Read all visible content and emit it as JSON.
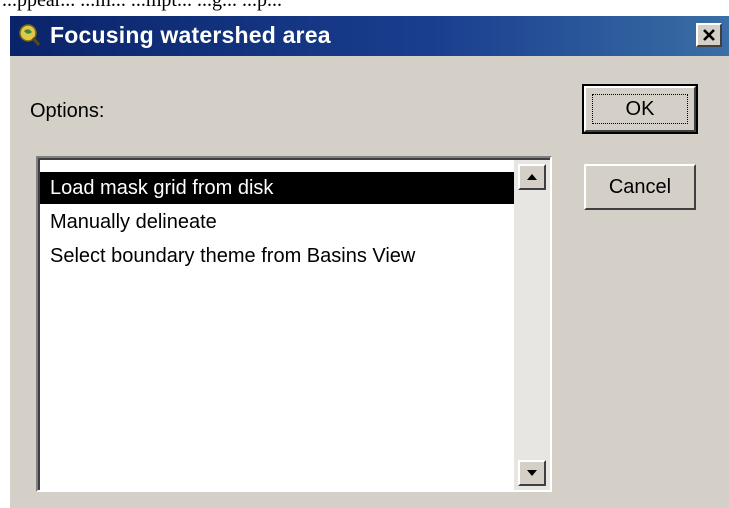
{
  "background_fragment": "...ppear... ...m... ...mpt... ...g... ...p...",
  "dialog": {
    "title": "Focusing watershed  area",
    "options_label": "Options:",
    "items": [
      "Load mask grid from disk",
      "Manually delineate",
      "Select boundary theme from Basins View"
    ],
    "selected_index": 0,
    "ok_label": "OK",
    "cancel_label": "Cancel"
  },
  "icons": {
    "app": "app-icon",
    "close": "close-icon",
    "scroll_up": "up-arrow-icon",
    "scroll_down": "down-arrow-icon"
  },
  "colors": {
    "titlebar": "#0a246a",
    "dialog_face": "#d4d0c8",
    "selection": "#000000"
  }
}
